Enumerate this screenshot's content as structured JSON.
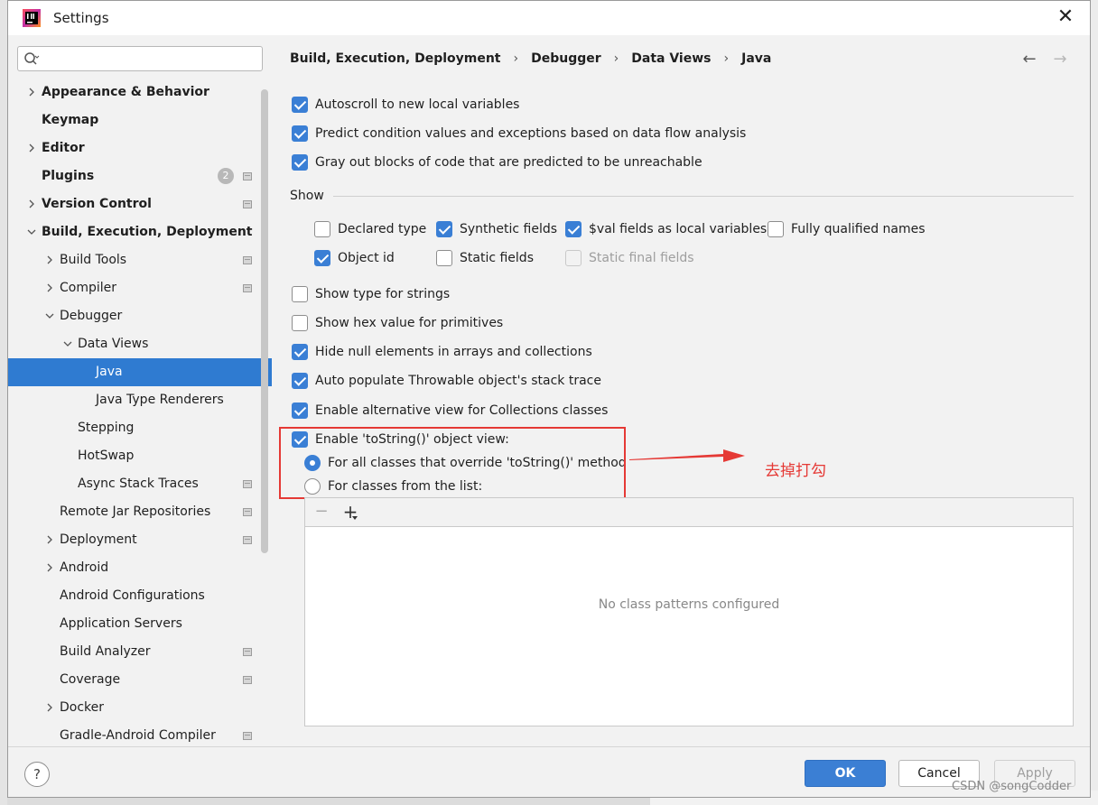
{
  "window": {
    "title": "Settings"
  },
  "search": {
    "placeholder": "",
    "value": ""
  },
  "sidebar": {
    "items": [
      {
        "label": "Appearance & Behavior",
        "level": 0,
        "arrow": "right",
        "bold": true,
        "badge": "",
        "project": false,
        "selected": false
      },
      {
        "label": "Keymap",
        "level": 0,
        "arrow": "none",
        "bold": true,
        "badge": "",
        "project": false,
        "selected": false
      },
      {
        "label": "Editor",
        "level": 0,
        "arrow": "right",
        "bold": true,
        "badge": "",
        "project": false,
        "selected": false
      },
      {
        "label": "Plugins",
        "level": 0,
        "arrow": "none",
        "bold": true,
        "badge": "2",
        "project": true,
        "selected": false
      },
      {
        "label": "Version Control",
        "level": 0,
        "arrow": "right",
        "bold": true,
        "badge": "",
        "project": true,
        "selected": false
      },
      {
        "label": "Build, Execution, Deployment",
        "level": 0,
        "arrow": "down",
        "bold": true,
        "badge": "",
        "project": false,
        "selected": false
      },
      {
        "label": "Build Tools",
        "level": 1,
        "arrow": "right",
        "bold": false,
        "badge": "",
        "project": true,
        "selected": false
      },
      {
        "label": "Compiler",
        "level": 1,
        "arrow": "right",
        "bold": false,
        "badge": "",
        "project": true,
        "selected": false
      },
      {
        "label": "Debugger",
        "level": 1,
        "arrow": "down",
        "bold": false,
        "badge": "",
        "project": false,
        "selected": false
      },
      {
        "label": "Data Views",
        "level": 2,
        "arrow": "down",
        "bold": false,
        "badge": "",
        "project": false,
        "selected": false
      },
      {
        "label": "Java",
        "level": 3,
        "arrow": "none",
        "bold": false,
        "badge": "",
        "project": false,
        "selected": true
      },
      {
        "label": "Java Type Renderers",
        "level": 3,
        "arrow": "none",
        "bold": false,
        "badge": "",
        "project": false,
        "selected": false
      },
      {
        "label": "Stepping",
        "level": 2,
        "arrow": "none",
        "bold": false,
        "badge": "",
        "project": false,
        "selected": false
      },
      {
        "label": "HotSwap",
        "level": 2,
        "arrow": "none",
        "bold": false,
        "badge": "",
        "project": false,
        "selected": false
      },
      {
        "label": "Async Stack Traces",
        "level": 2,
        "arrow": "none",
        "bold": false,
        "badge": "",
        "project": true,
        "selected": false
      },
      {
        "label": "Remote Jar Repositories",
        "level": 1,
        "arrow": "none",
        "bold": false,
        "badge": "",
        "project": true,
        "selected": false
      },
      {
        "label": "Deployment",
        "level": 1,
        "arrow": "right",
        "bold": false,
        "badge": "",
        "project": true,
        "selected": false
      },
      {
        "label": "Android",
        "level": 1,
        "arrow": "right",
        "bold": false,
        "badge": "",
        "project": false,
        "selected": false
      },
      {
        "label": "Android Configurations",
        "level": 1,
        "arrow": "none",
        "bold": false,
        "badge": "",
        "project": false,
        "selected": false
      },
      {
        "label": "Application Servers",
        "level": 1,
        "arrow": "none",
        "bold": false,
        "badge": "",
        "project": false,
        "selected": false
      },
      {
        "label": "Build Analyzer",
        "level": 1,
        "arrow": "none",
        "bold": false,
        "badge": "",
        "project": true,
        "selected": false
      },
      {
        "label": "Coverage",
        "level": 1,
        "arrow": "none",
        "bold": false,
        "badge": "",
        "project": true,
        "selected": false
      },
      {
        "label": "Docker",
        "level": 1,
        "arrow": "right",
        "bold": false,
        "badge": "",
        "project": false,
        "selected": false
      },
      {
        "label": "Gradle-Android Compiler",
        "level": 1,
        "arrow": "none",
        "bold": false,
        "badge": "",
        "project": true,
        "selected": false
      }
    ]
  },
  "breadcrumb": {
    "parts": [
      "Build, Execution, Deployment",
      "Debugger",
      "Data Views",
      "Java"
    ],
    "separator": "›"
  },
  "nav": {
    "back": "←",
    "forward": "→"
  },
  "options": {
    "autoscroll": {
      "label": "Autoscroll to new local variables",
      "checked": true
    },
    "predict": {
      "label": "Predict condition values and exceptions based on data flow analysis",
      "checked": true
    },
    "grayout": {
      "label": "Gray out blocks of code that are predicted to be unreachable",
      "checked": true
    }
  },
  "show": {
    "title": "Show",
    "declared_type": {
      "label": "Declared type",
      "checked": false
    },
    "synthetic_fields": {
      "label": "Synthetic fields",
      "checked": true
    },
    "val_fields": {
      "label": "$val fields as local variables",
      "checked": true
    },
    "fully_qualified": {
      "label": "Fully qualified names",
      "checked": false
    },
    "object_id": {
      "label": "Object id",
      "checked": true
    },
    "static_fields": {
      "label": "Static fields",
      "checked": false
    },
    "static_final_fields": {
      "label": "Static final fields",
      "checked": false,
      "disabled": true
    }
  },
  "more": {
    "show_type_strings": {
      "label": "Show type for strings",
      "checked": false
    },
    "show_hex": {
      "label": "Show hex value for primitives",
      "checked": false
    },
    "hide_null": {
      "label": "Hide null elements in arrays and collections",
      "checked": true
    },
    "auto_populate": {
      "label": "Auto populate Throwable object's stack trace",
      "checked": true
    },
    "alt_view": {
      "label": "Enable alternative view for Collections classes",
      "checked": true
    },
    "tostring": {
      "label": "Enable 'toString()' object view:",
      "checked": true
    }
  },
  "tostring_mode": {
    "all_classes": {
      "label": "For all classes that override 'toString()' method",
      "selected": true
    },
    "from_list": {
      "label": "For classes from the list:",
      "selected": false
    }
  },
  "list": {
    "minus": "−",
    "plus": "+",
    "empty": "No class patterns configured"
  },
  "annotation": {
    "text": "去掉打勾",
    "color": "#e53935"
  },
  "footer": {
    "help": "?",
    "ok": "OK",
    "cancel": "Cancel",
    "apply": "Apply"
  },
  "watermark": "CSDN @songCodder",
  "colors": {
    "accent": "#3a7fd5",
    "selection": "#2f7bd1",
    "annotation": "#e53935"
  }
}
